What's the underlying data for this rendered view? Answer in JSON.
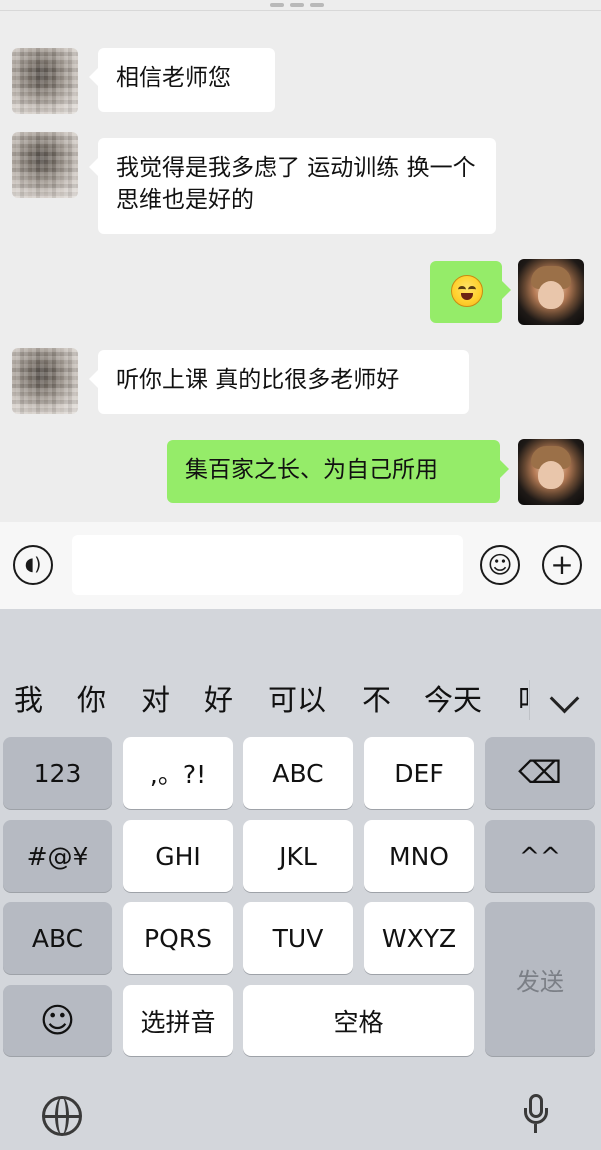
{
  "chat": {
    "messages": [
      {
        "side": "left",
        "text": "相信老师您"
      },
      {
        "side": "left",
        "text": "我觉得是我多虑了 运动训练 换一个思维也是好的"
      },
      {
        "side": "right",
        "type": "emoji",
        "icon_name": "laughing-crying-emoji-icon"
      },
      {
        "side": "left",
        "text": "听你上课 真的比很多老师好"
      },
      {
        "side": "right",
        "text": "集百家之长、为自己所用"
      }
    ]
  },
  "input_bar": {
    "voice_icon": "voice-icon",
    "emoji_icon": "emoji-icon",
    "add_icon": "add-icon",
    "message_value": ""
  },
  "keyboard": {
    "candidates": [
      "我",
      "你",
      "对",
      "好",
      "可以",
      "不",
      "今天",
      "吖"
    ],
    "rows": [
      [
        "123",
        ",。?!",
        "ABC",
        "DEF"
      ],
      [
        "#@¥",
        "GHI",
        "JKL",
        "MNO",
        "^^"
      ],
      [
        "ABC",
        "PQRS",
        "TUV",
        "WXYZ"
      ],
      [
        "☺",
        "选拼音",
        "空格"
      ]
    ],
    "send_label": "发送",
    "bottom_icons": [
      "globe-icon",
      "microphone-icon"
    ]
  }
}
